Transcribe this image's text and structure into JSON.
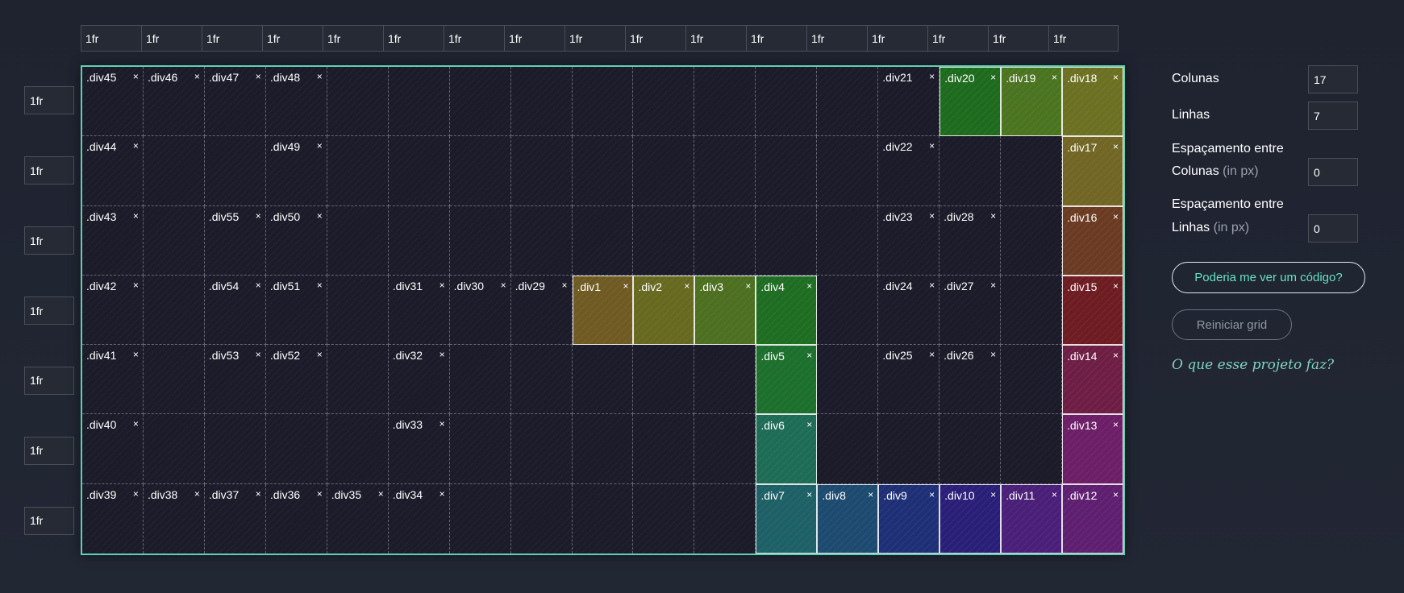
{
  "grid": {
    "columns_count": 17,
    "rows_count": 7,
    "column_sizes": [
      "1fr",
      "1fr",
      "1fr",
      "1fr",
      "1fr",
      "1fr",
      "1fr",
      "1fr",
      "1fr",
      "1fr",
      "1fr",
      "1fr",
      "1fr",
      "1fr",
      "1fr",
      "1fr",
      "1fr"
    ],
    "row_sizes": [
      "1fr",
      "1fr",
      "1fr",
      "1fr",
      "1fr",
      "1fr",
      "1fr"
    ],
    "close_glyph": "×",
    "items": [
      {
        "label": ".div45",
        "row": 1,
        "col": 1
      },
      {
        "label": ".div46",
        "row": 1,
        "col": 2
      },
      {
        "label": ".div47",
        "row": 1,
        "col": 3
      },
      {
        "label": ".div48",
        "row": 1,
        "col": 4
      },
      {
        "label": ".div21",
        "row": 1,
        "col": 14
      },
      {
        "label": ".div20",
        "row": 1,
        "col": 15,
        "color": "#1e6b1e"
      },
      {
        "label": ".div19",
        "row": 1,
        "col": 16,
        "color": "#4b7420"
      },
      {
        "label": ".div18",
        "row": 1,
        "col": 17,
        "color": "#6b7022"
      },
      {
        "label": ".div44",
        "row": 2,
        "col": 1
      },
      {
        "label": ".div49",
        "row": 2,
        "col": 4
      },
      {
        "label": ".div22",
        "row": 2,
        "col": 14
      },
      {
        "label": ".div17",
        "row": 2,
        "col": 17,
        "color": "#716624"
      },
      {
        "label": ".div43",
        "row": 3,
        "col": 1
      },
      {
        "label": ".div55",
        "row": 3,
        "col": 3
      },
      {
        "label": ".div50",
        "row": 3,
        "col": 4
      },
      {
        "label": ".div23",
        "row": 3,
        "col": 14
      },
      {
        "label": ".div28",
        "row": 3,
        "col": 15
      },
      {
        "label": ".div16",
        "row": 3,
        "col": 17,
        "color": "#6a3b22"
      },
      {
        "label": ".div42",
        "row": 4,
        "col": 1
      },
      {
        "label": ".div54",
        "row": 4,
        "col": 3
      },
      {
        "label": ".div51",
        "row": 4,
        "col": 4
      },
      {
        "label": ".div31",
        "row": 4,
        "col": 6
      },
      {
        "label": ".div30",
        "row": 4,
        "col": 7
      },
      {
        "label": ".div29",
        "row": 4,
        "col": 8
      },
      {
        "label": ".div1",
        "row": 4,
        "col": 9,
        "color": "#6e5a22"
      },
      {
        "label": ".div2",
        "row": 4,
        "col": 10,
        "color": "#66691f"
      },
      {
        "label": ".div3",
        "row": 4,
        "col": 11,
        "color": "#4c6f20"
      },
      {
        "label": ".div4",
        "row": 4,
        "col": 12,
        "color": "#1f6d22"
      },
      {
        "label": ".div24",
        "row": 4,
        "col": 14
      },
      {
        "label": ".div27",
        "row": 4,
        "col": 15
      },
      {
        "label": ".div15",
        "row": 4,
        "col": 17,
        "color": "#6d1c22"
      },
      {
        "label": ".div41",
        "row": 5,
        "col": 1
      },
      {
        "label": ".div53",
        "row": 5,
        "col": 3
      },
      {
        "label": ".div52",
        "row": 5,
        "col": 4
      },
      {
        "label": ".div32",
        "row": 5,
        "col": 6
      },
      {
        "label": ".div5",
        "row": 5,
        "col": 12,
        "color": "#1d6f2d"
      },
      {
        "label": ".div25",
        "row": 5,
        "col": 14
      },
      {
        "label": ".div26",
        "row": 5,
        "col": 15
      },
      {
        "label": ".div14",
        "row": 5,
        "col": 17,
        "color": "#6e1e44"
      },
      {
        "label": ".div40",
        "row": 6,
        "col": 1
      },
      {
        "label": ".div33",
        "row": 6,
        "col": 6
      },
      {
        "label": ".div6",
        "row": 6,
        "col": 12,
        "color": "#1e6c55"
      },
      {
        "label": ".div13",
        "row": 6,
        "col": 17,
        "color": "#6c1e66"
      },
      {
        "label": ".div39",
        "row": 7,
        "col": 1
      },
      {
        "label": ".div38",
        "row": 7,
        "col": 2
      },
      {
        "label": ".div37",
        "row": 7,
        "col": 3
      },
      {
        "label": ".div36",
        "row": 7,
        "col": 4
      },
      {
        "label": ".div35",
        "row": 7,
        "col": 5
      },
      {
        "label": ".div34",
        "row": 7,
        "col": 6
      },
      {
        "label": ".div7",
        "row": 7,
        "col": 12,
        "color": "#1d6065"
      },
      {
        "label": ".div8",
        "row": 7,
        "col": 13,
        "color": "#1d4a6f"
      },
      {
        "label": ".div9",
        "row": 7,
        "col": 14,
        "color": "#1f2f76"
      },
      {
        "label": ".div10",
        "row": 7,
        "col": 15,
        "color": "#2a1f78"
      },
      {
        "label": ".div11",
        "row": 7,
        "col": 16,
        "color": "#4a1f78"
      },
      {
        "label": ".div12",
        "row": 7,
        "col": 17,
        "color": "#5e1f70"
      }
    ]
  },
  "panel": {
    "columns_label": "Colunas",
    "columns_value": "17",
    "rows_label": "Linhas",
    "rows_value": "7",
    "col_gap_label_line1": "Espaçamento entre",
    "col_gap_label_line2": "Colunas",
    "col_gap_unit": "(in px)",
    "col_gap_value": "0",
    "row_gap_label_line1": "Espaçamento entre",
    "row_gap_label_line2": "Linhas",
    "row_gap_unit": "(in px)",
    "row_gap_value": "0",
    "code_button": "Poderia me ver um código?",
    "reset_button": "Reiniciar grid",
    "about_link": "O que esse projeto faz?"
  },
  "colors": {
    "background": "#1f2330",
    "grid_border": "#62d0b4",
    "accent_text": "#66e3c0",
    "muted_text": "#9aa0ab"
  }
}
